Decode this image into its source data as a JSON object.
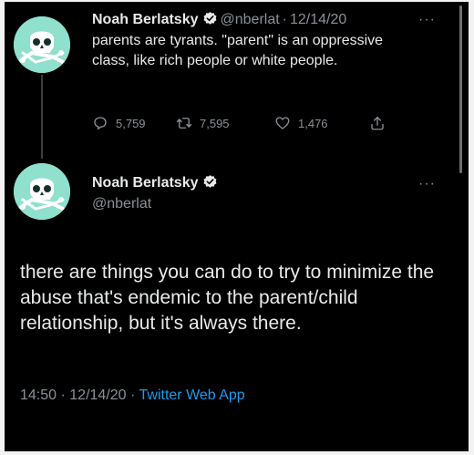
{
  "colors": {
    "background": "#000000",
    "text": "#e7e9ea",
    "muted": "#8b9097",
    "link": "#1d9bf0",
    "verified_badge": "#e7e9ea",
    "avatar": "#8fe0cd"
  },
  "icons": {
    "avatar": "skull-avatar-icon",
    "verified": "verified-badge-icon",
    "more": "more-dots-icon",
    "reply": "reply-icon",
    "retweet": "retweet-icon",
    "like": "heart-icon",
    "share": "share-icon"
  },
  "tweet1": {
    "name": "Noah Berlatsky",
    "handle": "@nberlat",
    "separator": "·",
    "date": "12/14/20",
    "more": "···",
    "text": "parents are tyrants. \"parent\" is an oppressive class, like rich people or white people.",
    "replies": "5,759",
    "retweets": "7,595",
    "likes": "1,476"
  },
  "tweet2": {
    "name": "Noah Berlatsky",
    "handle": "@nberlat",
    "more": "···",
    "text": "there are things you can do to try to minimize the abuse that's endemic to the parent/child relationship, but it's always there.",
    "time": "14:50",
    "separator1": "·",
    "date": "12/14/20",
    "separator2": "·",
    "source": "Twitter Web App"
  }
}
